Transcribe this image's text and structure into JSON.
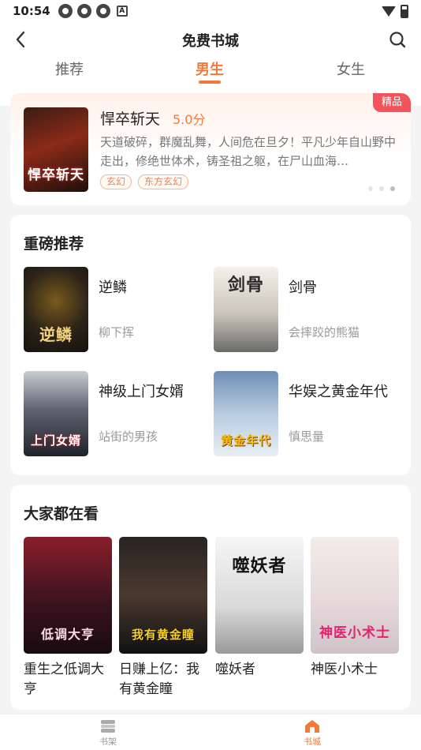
{
  "status_bar": {
    "time": "10:54",
    "icons": [
      "notification-icon",
      "notification-icon",
      "notification-icon",
      "a-icon"
    ],
    "right_icons": [
      "wifi-icon",
      "battery-icon"
    ]
  },
  "header": {
    "title": "免费书城",
    "back_icon": "back-arrow-icon",
    "search_icon": "search-icon"
  },
  "tabs": [
    {
      "label": "推荐",
      "active": false
    },
    {
      "label": "男生",
      "active": true
    },
    {
      "label": "女生",
      "active": false
    }
  ],
  "banner": {
    "title": "悍卒斩天",
    "score": "5.0分",
    "description": "天道破碎，群魔乱舞，人间危在旦夕！平凡少年自山野中走出，修绝世体术，铸圣祖之躯，在尸山血海…",
    "tags": [
      "玄幻",
      "东方玄幻"
    ],
    "badge": "精品",
    "cover_text": "悍卒斩天",
    "active_dot": 3
  },
  "featured": {
    "title": "重磅推荐",
    "books": [
      {
        "title": "逆鳞",
        "author": "柳下挥",
        "cover_text": "逆鳞"
      },
      {
        "title": "剑骨",
        "author": "会摔跤的熊猫",
        "cover_text": "剑骨"
      },
      {
        "title": "神级上门女婿",
        "author": "站街的男孩",
        "cover_text": "上门女婿"
      },
      {
        "title": "华娱之黄金年代",
        "author": "慎思量",
        "cover_text": "黄金年代"
      }
    ]
  },
  "popular": {
    "title": "大家都在看",
    "books": [
      {
        "title": "重生之低调大亨",
        "cover_text": "低调大亨"
      },
      {
        "title": "日赚上亿：我有黄金瞳",
        "cover_text": "我有黄金瞳"
      },
      {
        "title": "噬妖者",
        "cover_text": "噬妖者"
      },
      {
        "title": "神医小术士",
        "cover_text": "神医小术士"
      }
    ]
  },
  "bottom_nav": [
    {
      "label": "书架",
      "icon": "bookshelf-icon",
      "active": false
    },
    {
      "label": "书城",
      "icon": "bookstore-home-icon",
      "active": true
    }
  ],
  "colors": {
    "accent": "#f07a3a",
    "badge": "#f2545b"
  }
}
